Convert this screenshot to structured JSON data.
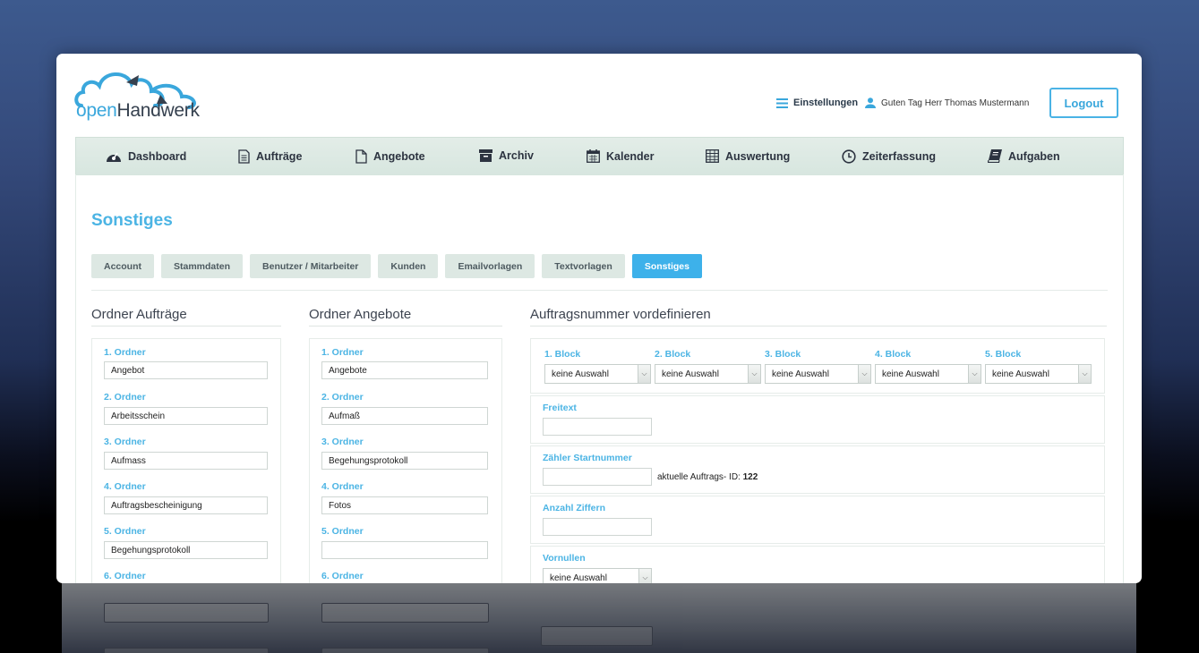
{
  "brand": {
    "open": "open",
    "handwerk": "Handwerk"
  },
  "header": {
    "settings_label": "Einstellungen",
    "user_greeting": "Guten Tag Herr Thomas Mustermann",
    "logout_label": "Logout"
  },
  "nav": [
    {
      "label": "Dashboard",
      "icon": "dashboard-icon"
    },
    {
      "label": "Aufträge",
      "icon": "document-lines-icon"
    },
    {
      "label": "Angebote",
      "icon": "document-icon"
    },
    {
      "label": "Archiv",
      "icon": "archive-box-icon"
    },
    {
      "label": "Kalender",
      "icon": "calendar-icon"
    },
    {
      "label": "Auswertung",
      "icon": "table-grid-icon"
    },
    {
      "label": "Zeiterfassung",
      "icon": "clock-icon"
    },
    {
      "label": "Aufgaben",
      "icon": "book-icon"
    }
  ],
  "page_title": "Sonstiges",
  "subtabs": [
    "Account",
    "Stammdaten",
    "Benutzer / Mitarbeiter",
    "Kunden",
    "Emailvorlagen",
    "Textvorlagen",
    "Sonstiges"
  ],
  "active_subtab": "Sonstiges",
  "ordner_auftraege": {
    "title": "Ordner Aufträge",
    "items": [
      {
        "label": "1. Ordner",
        "value": "Angebot"
      },
      {
        "label": "2. Ordner",
        "value": "Arbeitsschein"
      },
      {
        "label": "3. Ordner",
        "value": "Aufmass"
      },
      {
        "label": "4. Ordner",
        "value": "Auftragsbescheinigung"
      },
      {
        "label": "5. Ordner",
        "value": "Begehungsprotokoll"
      },
      {
        "label": "6. Ordner",
        "value": ""
      }
    ]
  },
  "ordner_angebote": {
    "title": "Ordner Angebote",
    "items": [
      {
        "label": "1. Ordner",
        "value": "Angebote"
      },
      {
        "label": "2. Ordner",
        "value": "Aufmaß"
      },
      {
        "label": "3. Ordner",
        "value": "Begehungsprotokoll"
      },
      {
        "label": "4. Ordner",
        "value": "Fotos"
      },
      {
        "label": "5. Ordner",
        "value": ""
      },
      {
        "label": "6. Ordner",
        "value": ""
      }
    ]
  },
  "auftragsnummer": {
    "title": "Auftragsnummer vordefinieren",
    "blocks": [
      {
        "label": "1. Block",
        "value": "keine Auswahl"
      },
      {
        "label": "2. Block",
        "value": "keine Auswahl"
      },
      {
        "label": "3. Block",
        "value": "keine Auswahl"
      },
      {
        "label": "4. Block",
        "value": "keine Auswahl"
      },
      {
        "label": "5. Block",
        "value": "keine Auswahl"
      }
    ],
    "freitext_label": "Freitext",
    "freitext_value": "",
    "zaehler_label": "Zähler Startnummer",
    "zaehler_value": "",
    "aktuelle_id_label": "aktuelle Auftrags- ID:",
    "aktuelle_id_value": "122",
    "anzahl_label": "Anzahl Ziffern",
    "anzahl_value": "",
    "vornullen_label": "Vornullen",
    "vornullen_value": "keine Auswahl"
  },
  "colors": {
    "accent": "#3db1ea",
    "nav_bg": "#dce9e3",
    "text_dark": "#2c3340"
  }
}
